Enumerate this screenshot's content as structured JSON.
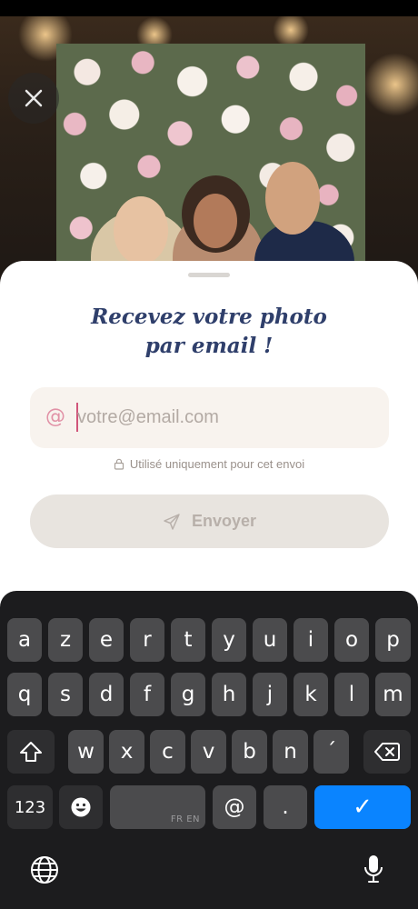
{
  "sheet": {
    "title_line1": "Recevez votre photo",
    "title_line2": "par email !",
    "email": {
      "value": "",
      "placeholder": "votre@email.com"
    },
    "note": "Utilisé uniquement pour cet envoi",
    "send_label": "Envoyer"
  },
  "keyboard": {
    "row1": [
      "a",
      "z",
      "e",
      "r",
      "t",
      "y",
      "u",
      "i",
      "o",
      "p"
    ],
    "row2": [
      "q",
      "s",
      "d",
      "f",
      "g",
      "h",
      "j",
      "k",
      "l",
      "m"
    ],
    "row3": [
      "w",
      "x",
      "c",
      "v",
      "b",
      "n",
      "´"
    ],
    "numbers_label": "123",
    "space_sublabel": "FR EN",
    "at_label": "@",
    "period_label": ".",
    "return_label": "✓"
  },
  "icons": [
    "close-icon",
    "at-icon",
    "lock-icon",
    "send-icon",
    "shift-icon",
    "delete-icon",
    "emoji-icon",
    "globe-icon",
    "microphone-icon"
  ],
  "colors": {
    "title": "#2f3f6b",
    "accent": "#e191a6",
    "keyboard_accent": "#0a84ff"
  }
}
